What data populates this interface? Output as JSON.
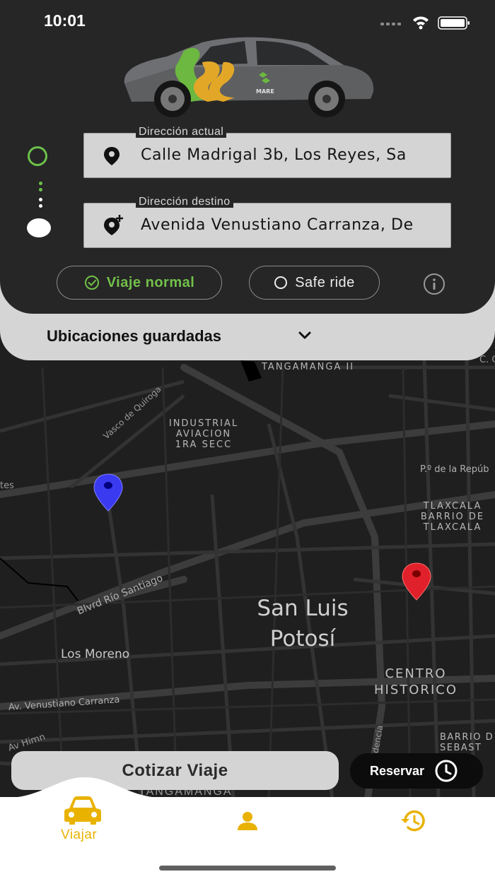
{
  "status_bar": {
    "time": "10:01"
  },
  "route": {
    "origin": {
      "label": "Dirección actual",
      "value": "Calle Madrigal 3b, Los Reyes, Sa"
    },
    "destination": {
      "label": "Dirección destino",
      "value": "Avenida Venustiano Carranza, De"
    }
  },
  "ride_options": {
    "normal_label": "Viaje normal",
    "safe_label": "Safe ride",
    "selected": "normal"
  },
  "saved_locations": {
    "label": "Ubicaciones guardadas"
  },
  "car_brand": "MARE",
  "map": {
    "labels": {
      "tangamanga_ii": "TANGAMANGA II",
      "industrial_1": "INDUSTRIAL",
      "industrial_2": "AVIACION",
      "industrial_3": "1RA SECC",
      "vasco": "Vasco de Quiroga",
      "republica": "P.º de la Repúb",
      "tlaxcala_1": "TLAXCALA",
      "tlaxcala_2": "BARRIO DE",
      "tlaxcala_3": "TLAXCALA",
      "rio_santiago": "Blvrd Río Santiago",
      "city_1": "San Luis",
      "city_2": "Potosí",
      "los_moreno": "Los Moreno",
      "centro_1": "CENTRO",
      "centro_2": "HISTORICO",
      "venustiano": "Av. Venustiano Carranza",
      "himno": "Av Himn",
      "barrio_1": "BARRIO D",
      "barrio_2": "SEBAST",
      "tes": "tes",
      "c_o": "C. O",
      "idencia": "idencia",
      "tangamanga_bottom": "TANGAMANGA"
    }
  },
  "actions": {
    "quote_label": "Cotizar Viaje",
    "reserve_label": "Reservar"
  },
  "tabs": {
    "travel_label": "Viajar"
  },
  "colors": {
    "accent_yellow": "#e9b200",
    "accent_green": "#6cc04a",
    "panel_dark": "#262626",
    "pin_blue": "#3a3af0",
    "pin_red": "#e0202a"
  }
}
